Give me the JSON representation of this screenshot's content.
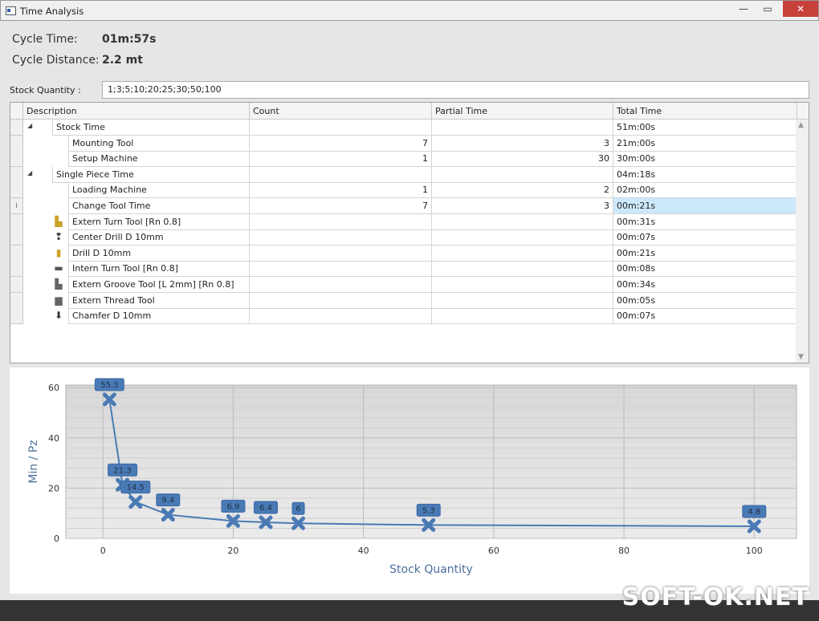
{
  "window": {
    "title": "Time Analysis",
    "minimize": "—",
    "maximize": "▭",
    "close": "✕"
  },
  "summary": {
    "cycle_time_label": "Cycle Time:",
    "cycle_time": "01m:57s",
    "cycle_distance_label": "Cycle Distance:",
    "cycle_distance": "2.2 mt"
  },
  "stock_quantity": {
    "label": "Stock Quantity :",
    "value": "1;3;5;10;20;25;30;50;100"
  },
  "table": {
    "columns": [
      "Description",
      "Count",
      "Partial Time",
      "Total Time"
    ],
    "rows": [
      {
        "level": 0,
        "expander": "◢",
        "description": "Stock Time",
        "count": "",
        "partial": "",
        "total": "51m:00s"
      },
      {
        "level": 1,
        "description": "Mounting Tool",
        "count": "7",
        "partial": "3",
        "total": "21m:00s"
      },
      {
        "level": 1,
        "description": "Setup Machine",
        "count": "1",
        "partial": "30",
        "total": "30m:00s"
      },
      {
        "level": 0,
        "expander": "◢",
        "description": "Single Piece Time",
        "count": "",
        "partial": "",
        "total": "04m:18s"
      },
      {
        "level": 1,
        "description": "Loading Machine",
        "count": "1",
        "partial": "2",
        "total": "02m:00s"
      },
      {
        "level": 1,
        "description": "Change Tool Time",
        "count": "7",
        "partial": "3",
        "total": "00m:21s",
        "selected": true,
        "row_marker": "I"
      },
      {
        "level": 2,
        "icon": "extern-turn-tool",
        "description": "Extern Turn Tool  [Rn 0.8]",
        "count": "",
        "partial": "",
        "total": "00m:31s"
      },
      {
        "level": 2,
        "icon": "center-drill",
        "description": "Center Drill D 10mm",
        "count": "",
        "partial": "",
        "total": "00m:07s"
      },
      {
        "level": 2,
        "icon": "drill",
        "description": "Drill  D 10mm",
        "count": "",
        "partial": "",
        "total": "00m:21s"
      },
      {
        "level": 2,
        "icon": "intern-turn-tool",
        "description": "Intern Turn Tool  [Rn 0.8]",
        "count": "",
        "partial": "",
        "total": "00m:08s"
      },
      {
        "level": 2,
        "icon": "extern-groove-tool",
        "description": "Extern Groove Tool [L 2mm] [Rn 0.8]",
        "count": "",
        "partial": "",
        "total": "00m:34s"
      },
      {
        "level": 2,
        "icon": "extern-thread-tool",
        "description": "Extern Thread Tool",
        "count": "",
        "partial": "",
        "total": "00m:05s"
      },
      {
        "level": 2,
        "icon": "chamfer",
        "description": "Chamfer D 10mm",
        "count": "",
        "partial": "",
        "total": "00m:07s"
      }
    ]
  },
  "chart_data": {
    "type": "line",
    "xlabel": "Stock Quantity",
    "ylabel": "Min / Pz",
    "x": [
      1,
      3,
      5,
      10,
      20,
      25,
      30,
      50,
      100
    ],
    "values": [
      55.3,
      21.3,
      14.5,
      9.4,
      6.9,
      6.4,
      6,
      5.3,
      4.8
    ],
    "labels": [
      "55.3",
      "21.3",
      "14.5",
      "9.4",
      "6.9",
      "6.4",
      "6",
      "5.3",
      "4.8"
    ],
    "xlim": [
      -5.7,
      106.5
    ],
    "ylim": [
      0,
      61
    ],
    "xticks": [
      0,
      20,
      40,
      60,
      80,
      100
    ],
    "yticks": [
      0,
      20,
      40,
      60
    ],
    "grid": true,
    "color": "#4a7ab5"
  },
  "watermark": "SOFT-OK.NET"
}
